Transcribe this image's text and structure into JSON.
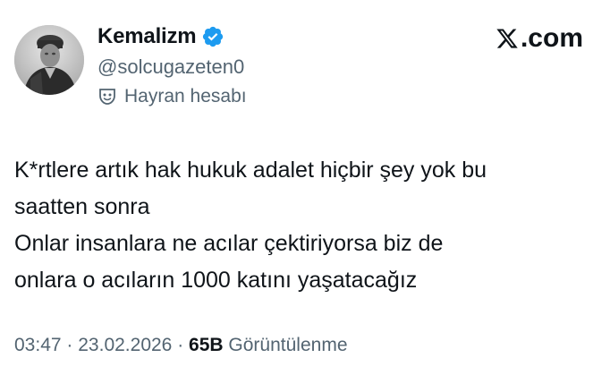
{
  "author": {
    "display_name": "Kemalizm",
    "handle": "@solcugazeten0",
    "label": "Hayran hesabı",
    "avatar_icon": "portrait-avatar",
    "verified_icon": "verified-badge-icon",
    "verified_color": "#1d9bf0"
  },
  "brand": {
    "text": ".com",
    "icon": "x-logo-icon"
  },
  "tweet": {
    "lines": [
      "K*rtlere artık hak hukuk adalet hiçbir şey yok bu",
      "saatten sonra",
      "Onlar insanlara ne acılar çektiriyorsa biz de",
      "onlara o acıların 1000 katını yaşatacağız"
    ]
  },
  "meta": {
    "time": "03:47",
    "sep1": "·",
    "date": "23.02.2026",
    "sep2": "·",
    "views_count": "65B",
    "views_label": "Görüntülenme"
  },
  "colors": {
    "text": "#0f1419",
    "secondary": "#536471",
    "accent": "#1d9bf0"
  }
}
